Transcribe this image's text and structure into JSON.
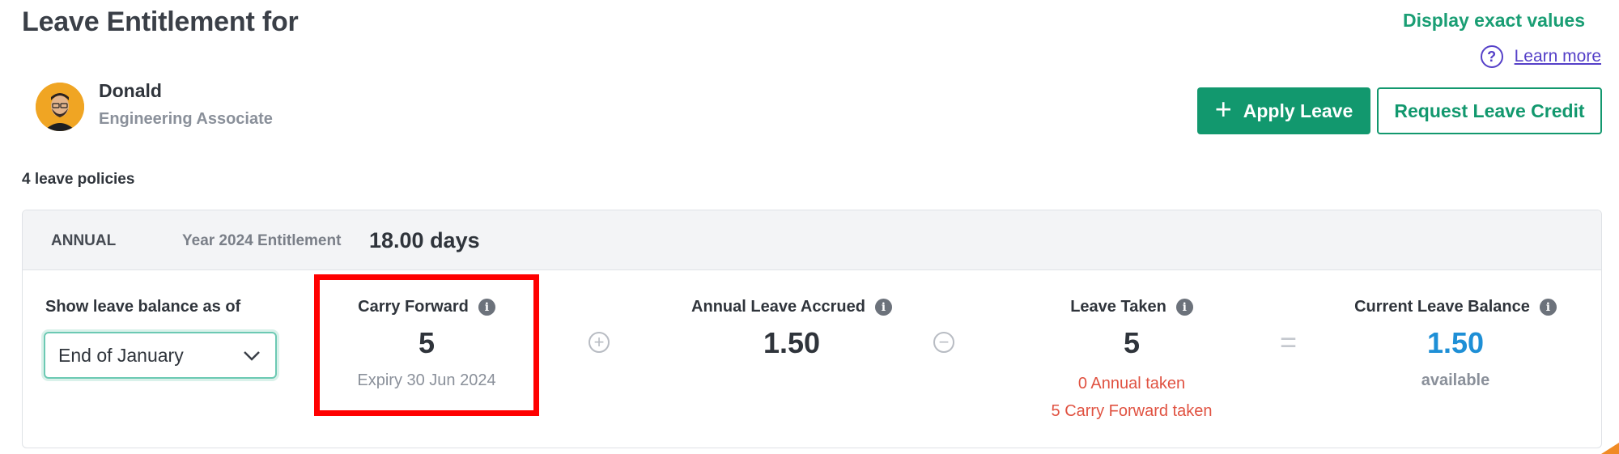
{
  "header": {
    "title": "Leave Entitlement for",
    "display_exact": "Display exact values",
    "learn_more": "Learn more",
    "help_icon": "question-circle-icon"
  },
  "user": {
    "name": "Donald",
    "role": "Engineering Associate",
    "avatar_icon": "user-avatar"
  },
  "actions": {
    "apply_leave": "Apply Leave",
    "apply_icon": "+",
    "request_credit": "Request Leave Credit"
  },
  "policies": {
    "count_text": "4 leave policies"
  },
  "policy_card": {
    "type": "ANNUAL",
    "entitlement_label": "Year 2024 Entitlement",
    "entitlement_value": "18.00 days",
    "balance_as_of_label": "Show leave balance as of",
    "balance_as_of_value": "End of January",
    "carry_forward": {
      "label": "Carry Forward",
      "value": "5",
      "sub": "Expiry 30 Jun 2024"
    },
    "accrued": {
      "label": "Annual Leave Accrued",
      "value": "1.50"
    },
    "taken": {
      "label": "Leave Taken",
      "value": "5",
      "sub1": "0 Annual taken",
      "sub2": "5 Carry Forward taken"
    },
    "balance": {
      "label": "Current Leave Balance",
      "value": "1.50",
      "sub": "available"
    },
    "operators": {
      "plus": "+",
      "minus": "−",
      "equals": "="
    }
  },
  "colors": {
    "primary": "#12986e",
    "link": "#5540c8",
    "balance": "#1e8fd6",
    "taken_sub": "#e05241",
    "highlight": "#ff0000"
  }
}
